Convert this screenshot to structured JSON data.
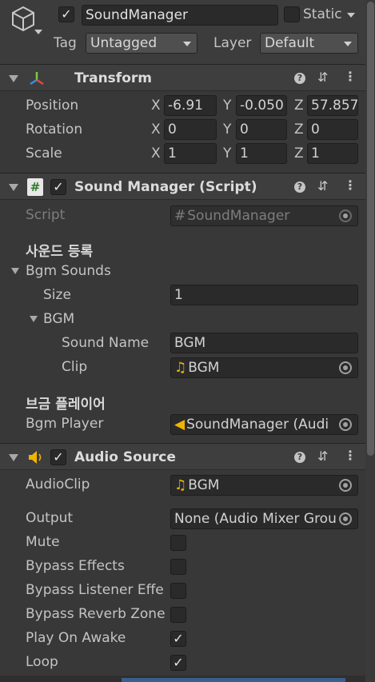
{
  "gameobject": {
    "active": "✓",
    "name": "SoundManager",
    "static_label": "Static",
    "tag_label": "Tag",
    "tag_value": "Untagged",
    "layer_label": "Layer",
    "layer_value": "Default"
  },
  "transform": {
    "title": "Transform",
    "position_label": "Position",
    "rotation_label": "Rotation",
    "scale_label": "Scale",
    "axis_x": "X",
    "axis_y": "Y",
    "axis_z": "Z",
    "position": {
      "x": "-6.91",
      "y": "-0.050",
      "z": "57.857"
    },
    "rotation": {
      "x": "0",
      "y": "0",
      "z": "0"
    },
    "scale": {
      "x": "1",
      "y": "1",
      "z": "1"
    }
  },
  "script_component": {
    "enabled": "✓",
    "title": "Sound Manager (Script)",
    "script_label": "Script",
    "script_value": "SoundManager",
    "script_icon": "#",
    "header_sound": "사운드 등록",
    "bgm_sounds_label": "Bgm Sounds",
    "size_label": "Size",
    "size_value": "1",
    "element_label": "BGM",
    "sound_name_label": "Sound Name",
    "sound_name_value": "BGM",
    "clip_label": "Clip",
    "clip_value": "BGM",
    "header_player": "브금 플레이어",
    "bgm_player_label": "Bgm Player",
    "bgm_player_value": "SoundManager (Audi"
  },
  "audio_source": {
    "enabled": "✓",
    "title": "Audio Source",
    "audioclip_label": "AudioClip",
    "audioclip_value": "BGM",
    "output_label": "Output",
    "output_value": "None (Audio Mixer Grou",
    "mute_label": "Mute",
    "bypass_effects_label": "Bypass Effects",
    "bypass_listener_label": "Bypass Listener Effe",
    "bypass_reverb_label": "Bypass Reverb Zone",
    "play_on_awake_label": "Play On Awake",
    "play_on_awake_value": "✓",
    "loop_label": "Loop",
    "loop_value": "✓"
  },
  "icons": {
    "gameobject": "cube-icon",
    "transform": "transform-axes-icon",
    "script": "script-icon",
    "audio": "speaker-icon",
    "help": "help-icon",
    "presets": "sliders-icon",
    "menu": "kebab-menu-icon",
    "object_picker": "object-picker-icon",
    "music_note": "music-note-icon"
  },
  "colors": {
    "panel_bg": "#383838",
    "header_bg": "#3e3e3e",
    "field_bg": "#2a2a2a",
    "audio_icon": "#f0b400",
    "clip_icon": "#f0b400"
  }
}
